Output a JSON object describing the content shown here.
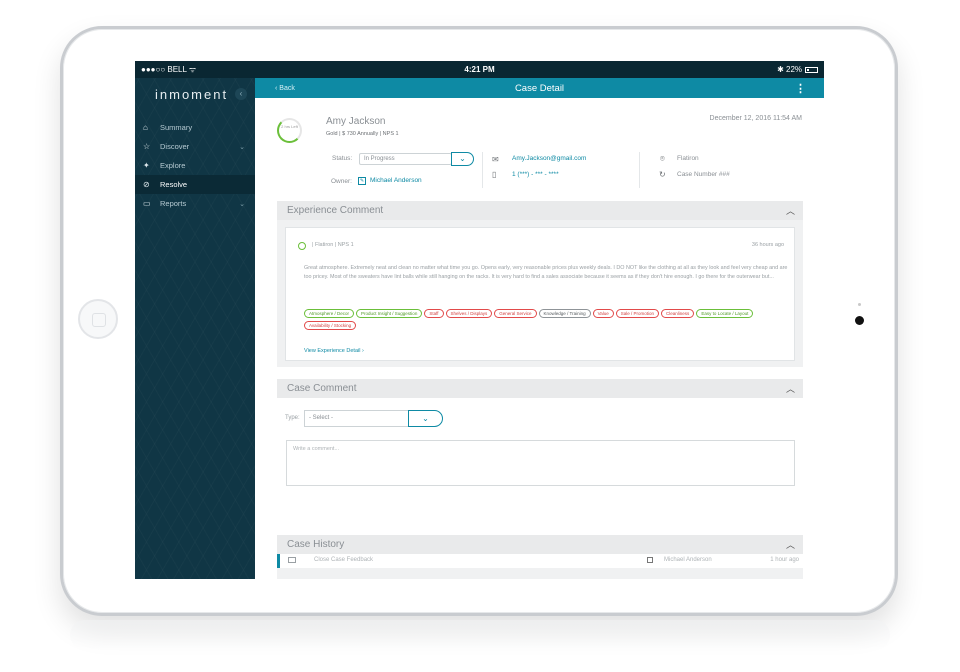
{
  "statusbar": {
    "carrier": "●●●○○ BELL ᯤ",
    "time": "4:21 PM",
    "battery": "✱ 22%"
  },
  "sidebar": {
    "brand": "inmoment",
    "collapse": "‹",
    "items": [
      {
        "label": "Summary",
        "icon": "home-icon",
        "glyph": "⌂"
      },
      {
        "label": "Discover",
        "icon": "star-icon",
        "glyph": "☆",
        "chevron": "⌄"
      },
      {
        "label": "Explore",
        "icon": "pin-icon",
        "glyph": "✦"
      },
      {
        "label": "Resolve",
        "icon": "check-circle-icon",
        "glyph": "⊘"
      },
      {
        "label": "Reports",
        "icon": "folder-icon",
        "glyph": "▭",
        "chevron": "⌄"
      }
    ]
  },
  "appbar": {
    "back": "‹ Back",
    "title": "Case Detail",
    "menu": "⋮"
  },
  "customer": {
    "score": "2 hrs Left",
    "name": "Amy Jackson",
    "meta": "Gold | $ 730 Annually | NPS 1",
    "date": "December 12, 2016 11:54 AM",
    "status_label": "Status:",
    "status_value": "In Progress",
    "owner_label": "Owner:",
    "owner_name": "Michael Anderson",
    "email": "Amy.Jackson@gmail.com",
    "phone": "1 (***) - *** - ****",
    "location": "Flatiron",
    "case_number": "Case Number ###"
  },
  "experience": {
    "title": "Experience Comment",
    "meta": "|  Flatiron  |  NPS 1",
    "time": "36 hours ago",
    "text": "Great atmosphere. Extremely neat and clean no matter what time you go. Opens early, very reasonable prices plus weekly deals. I DO NOT like the clothing at all as they look and feel very cheap and are too pricey. Most of the sweaters have lint balls while still hanging on the racks. It is very hard to find a sales associate because it seems as if they don't hire enough. I go there for the outerwear but...",
    "tags": [
      {
        "label": "Atmosphere / Decor",
        "tone": "g"
      },
      {
        "label": "Product Insight / Suggestion",
        "tone": "g"
      },
      {
        "label": "Staff",
        "tone": "r"
      },
      {
        "label": "Shelves / Displays",
        "tone": "r"
      },
      {
        "label": "General Service",
        "tone": "r"
      },
      {
        "label": "Knowledge / Training",
        "tone": "k"
      },
      {
        "label": "Value",
        "tone": "r"
      },
      {
        "label": "Sale / Promotion",
        "tone": "r"
      },
      {
        "label": "Cleanliness",
        "tone": "r"
      },
      {
        "label": "Easy to Locate / Layout",
        "tone": "g"
      },
      {
        "label": "Availability / Stocking",
        "tone": "r"
      }
    ],
    "view_link": "View Experience Detail ›"
  },
  "case_comment": {
    "title": "Case Comment",
    "type_label": "Type:",
    "type_value": "- Select -",
    "placeholder": "Write a comment..."
  },
  "case_history": {
    "title": "Case History",
    "row_text": "Close Case Feedback",
    "row_user": "Michael Anderson",
    "row_time": "1 hour ago"
  }
}
